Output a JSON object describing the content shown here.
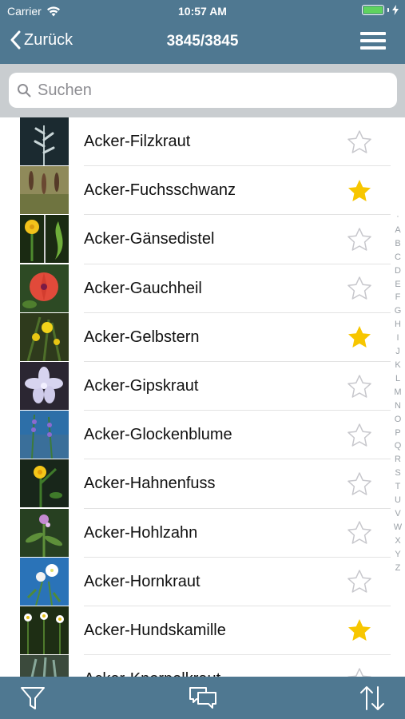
{
  "status": {
    "carrier": "Carrier",
    "time": "10:57 AM",
    "battery_level": 1.0
  },
  "nav": {
    "back_label": "Zurück",
    "title": "3845/3845"
  },
  "search": {
    "placeholder": "Suchen"
  },
  "plants": [
    {
      "name": "Acker-Filzkraut",
      "favorite": false,
      "thumb": "filzkraut"
    },
    {
      "name": "Acker-Fuchsschwanz",
      "favorite": true,
      "thumb": "fuchsschwanz"
    },
    {
      "name": "Acker-Gänsedistel",
      "favorite": false,
      "thumb": "gaensedistel"
    },
    {
      "name": "Acker-Gauchheil",
      "favorite": false,
      "thumb": "gauchheil"
    },
    {
      "name": "Acker-Gelbstern",
      "favorite": true,
      "thumb": "gelbstern"
    },
    {
      "name": "Acker-Gipskraut",
      "favorite": false,
      "thumb": "gipskraut"
    },
    {
      "name": "Acker-Glockenblume",
      "favorite": false,
      "thumb": "glockenblume"
    },
    {
      "name": "Acker-Hahnenfuss",
      "favorite": false,
      "thumb": "hahnenfuss"
    },
    {
      "name": "Acker-Hohlzahn",
      "favorite": false,
      "thumb": "hohlzahn"
    },
    {
      "name": "Acker-Hornkraut",
      "favorite": false,
      "thumb": "hornkraut"
    },
    {
      "name": "Acker-Hundskamille",
      "favorite": true,
      "thumb": "hundskamille"
    },
    {
      "name": "Acker-Knorpelkraut",
      "favorite": false,
      "thumb": "knorpelkraut"
    }
  ],
  "index_letters": [
    "·",
    "A",
    "B",
    "C",
    "D",
    "E",
    "F",
    "G",
    "H",
    "I",
    "J",
    "K",
    "L",
    "M",
    "N",
    "O",
    "P",
    "Q",
    "R",
    "S",
    "T",
    "U",
    "V",
    "W",
    "X",
    "Y",
    "Z"
  ],
  "tabs": {
    "filter_icon": "filter-icon",
    "chat_icon": "chat-icon",
    "sort_icon": "sort-icon"
  },
  "colors": {
    "bar": "#4f7891",
    "star_filled": "#f7c600",
    "star_empty": "#c7c7cc",
    "search_bg": "#c9cdd0"
  }
}
